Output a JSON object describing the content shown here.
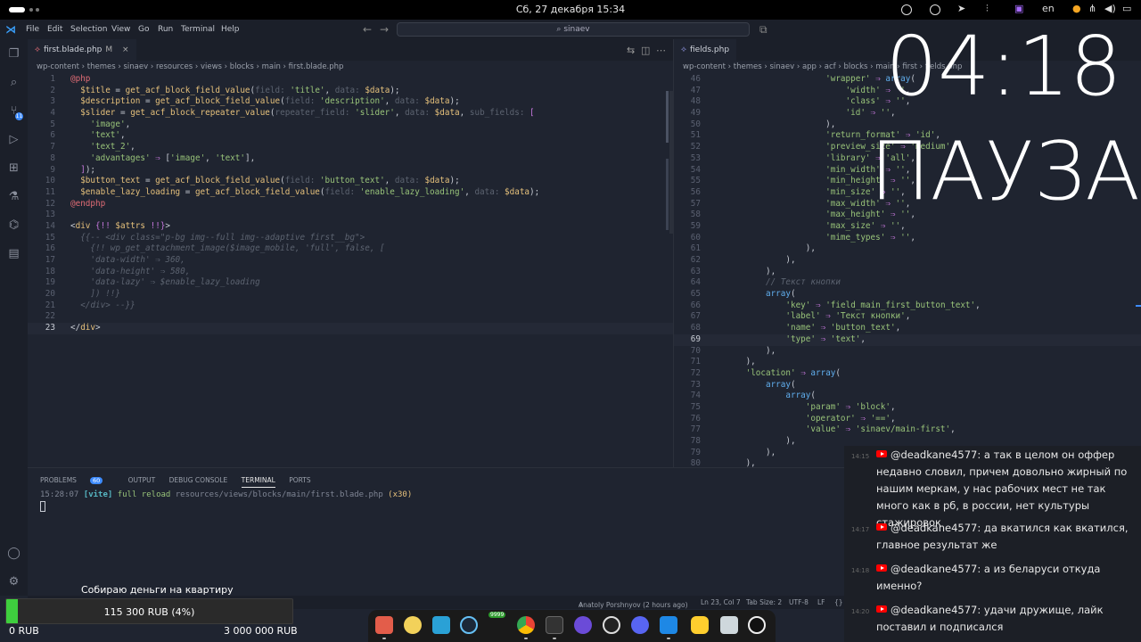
{
  "system": {
    "clock": "Сб, 27 декабря 15:34",
    "keyboard_layout": "en"
  },
  "titlebar": {
    "menu": [
      "File",
      "Edit",
      "Selection",
      "View",
      "Go",
      "Run",
      "Terminal",
      "Help"
    ],
    "search": "sinaev"
  },
  "activity_bar": {
    "scm_badge": "11"
  },
  "editor_left": {
    "tab": "first.blade.php",
    "tab_modified": "M",
    "breadcrumb": [
      "wp-content",
      "themes",
      "sinaev",
      "resources",
      "views",
      "blocks",
      "main",
      "first.blade.php"
    ],
    "current_line": 23,
    "lines": [
      {
        "n": 1,
        "html": "<span style='color:#e06c75'>@php</span>"
      },
      {
        "n": 2,
        "html": "  <span style='color:#e5c07b'>$title</span> = <span style='color:#e5c07b'>get_acf_block_field_value</span>(<span style='color:#5c6370'>field: </span><span style='color:#98c379'>'title'</span>, <span style='color:#5c6370'>data: </span><span style='color:#e5c07b'>$data</span>);"
      },
      {
        "n": 3,
        "html": "  <span style='color:#e5c07b'>$description</span> = <span style='color:#e5c07b'>get_acf_block_field_value</span>(<span style='color:#5c6370'>field: </span><span style='color:#98c379'>'description'</span>, <span style='color:#5c6370'>data: </span><span style='color:#e5c07b'>$data</span>);"
      },
      {
        "n": 4,
        "html": "  <span style='color:#e5c07b'>$slider</span> = <span style='color:#e5c07b'>get_acf_block_repeater_value</span>(<span style='color:#5c6370'>repeater_field: </span><span style='color:#98c379'>'slider'</span>, <span style='color:#5c6370'>data: </span><span style='color:#e5c07b'>$data</span>, <span style='color:#5c6370'>sub_fields: </span><span style='color:#c678dd'>[</span>"
      },
      {
        "n": 5,
        "html": "    <span style='color:#98c379'>'image'</span>,"
      },
      {
        "n": 6,
        "html": "    <span style='color:#98c379'>'text'</span>,"
      },
      {
        "n": 7,
        "html": "    <span style='color:#98c379'>'text_2'</span>,"
      },
      {
        "n": 8,
        "html": "    <span style='color:#98c379'>'advantages'</span> <span style='color:#c678dd'>⇒</span> [<span style='color:#98c379'>'image'</span>, <span style='color:#98c379'>'text'</span>],"
      },
      {
        "n": 9,
        "html": "  <span style='color:#c678dd'>]</span>);"
      },
      {
        "n": 10,
        "html": "  <span style='color:#e5c07b'>$button_text</span> = <span style='color:#e5c07b'>get_acf_block_field_value</span>(<span style='color:#5c6370'>field: </span><span style='color:#98c379'>'button_text'</span>, <span style='color:#5c6370'>data: </span><span style='color:#e5c07b'>$data</span>);"
      },
      {
        "n": 11,
        "html": "  <span style='color:#e5c07b'>$enable_lazy_loading</span> = <span style='color:#e5c07b'>get_acf_block_field_value</span>(<span style='color:#5c6370'>field: </span><span style='color:#98c379'>'enable_lazy_loading'</span>, <span style='color:#5c6370'>data: </span><span style='color:#e5c07b'>$data</span>);"
      },
      {
        "n": 12,
        "html": "<span style='color:#e06c75'>@endphp</span>"
      },
      {
        "n": 13,
        "html": ""
      },
      {
        "n": 14,
        "html": "&lt;<span style='color:#e5c07b'>div</span> <span style='color:#c678dd'>{!!</span> <span style='color:#e5c07b'>$attrs</span> <span style='color:#c678dd'>!!}</span>&gt;"
      },
      {
        "n": 15,
        "html": "  <span style='color:#5c6370;font-style:italic'>{{-- &lt;div class=\"p-bg img--full img--adaptive first__bg\"&gt;</span>"
      },
      {
        "n": 16,
        "html": "    <span style='color:#5c6370;font-style:italic'>{!! wp_get_attachment_image($image_mobile, 'full', false, [</span>"
      },
      {
        "n": 17,
        "html": "    <span style='color:#5c6370;font-style:italic'>'data-width' ⇒ 360,</span>"
      },
      {
        "n": 18,
        "html": "    <span style='color:#5c6370;font-style:italic'>'data-height' ⇒ 580,</span>"
      },
      {
        "n": 19,
        "html": "    <span style='color:#5c6370;font-style:italic'>'data-lazy' ⇒ $enable_lazy_loading</span>"
      },
      {
        "n": 20,
        "html": "    <span style='color:#5c6370;font-style:italic'>]) !!}</span>"
      },
      {
        "n": 21,
        "html": "  <span style='color:#5c6370;font-style:italic'>&lt;/div&gt; --}}</span>"
      },
      {
        "n": 22,
        "html": ""
      },
      {
        "n": 23,
        "html": "&lt;/<span style='color:#e5c07b'>div</span>&gt;"
      }
    ]
  },
  "editor_right": {
    "tab": "fields.php",
    "breadcrumb": [
      "wp-content",
      "themes",
      "sinaev",
      "app",
      "acf",
      "blocks",
      "main",
      "first",
      "fields.php"
    ],
    "current_line": 69,
    "lines": [
      {
        "n": 46,
        "html": "                      <span style='color:#98c379'>'wrapper'</span> <span style='color:#c678dd'>⇒</span> <span style='color:#61afef'>array</span>("
      },
      {
        "n": 47,
        "html": "                          <span style='color:#98c379'>'width'</span> <span style='color:#c678dd'>⇒</span> <span style='color:#98c379'>''</span>,"
      },
      {
        "n": 48,
        "html": "                          <span style='color:#98c379'>'class'</span> <span style='color:#c678dd'>⇒</span> <span style='color:#98c379'>''</span>,"
      },
      {
        "n": 49,
        "html": "                          <span style='color:#98c379'>'id'</span> <span style='color:#c678dd'>⇒</span> <span style='color:#98c379'>''</span>,"
      },
      {
        "n": 50,
        "html": "                      ),"
      },
      {
        "n": 51,
        "html": "                      <span style='color:#98c379'>'return_format'</span> <span style='color:#c678dd'>⇒</span> <span style='color:#98c379'>'id'</span>,"
      },
      {
        "n": 52,
        "html": "                      <span style='color:#98c379'>'preview_size'</span> <span style='color:#c678dd'>⇒</span> <span style='color:#98c379'>'medium'</span>,"
      },
      {
        "n": 53,
        "html": "                      <span style='color:#98c379'>'library'</span> <span style='color:#c678dd'>⇒</span> <span style='color:#98c379'>'all'</span>,"
      },
      {
        "n": 54,
        "html": "                      <span style='color:#98c379'>'min_width'</span> <span style='color:#c678dd'>⇒</span> <span style='color:#98c379'>''</span>,"
      },
      {
        "n": 55,
        "html": "                      <span style='color:#98c379'>'min_height'</span> <span style='color:#c678dd'>⇒</span> <span style='color:#98c379'>''</span>,"
      },
      {
        "n": 56,
        "html": "                      <span style='color:#98c379'>'min_size'</span> <span style='color:#c678dd'>⇒</span> <span style='color:#98c379'>''</span>,"
      },
      {
        "n": 57,
        "html": "                      <span style='color:#98c379'>'max_width'</span> <span style='color:#c678dd'>⇒</span> <span style='color:#98c379'>''</span>,"
      },
      {
        "n": 58,
        "html": "                      <span style='color:#98c379'>'max_height'</span> <span style='color:#c678dd'>⇒</span> <span style='color:#98c379'>''</span>,"
      },
      {
        "n": 59,
        "html": "                      <span style='color:#98c379'>'max_size'</span> <span style='color:#c678dd'>⇒</span> <span style='color:#98c379'>''</span>,"
      },
      {
        "n": 60,
        "html": "                      <span style='color:#98c379'>'mime_types'</span> <span style='color:#c678dd'>⇒</span> <span style='color:#98c379'>''</span>,"
      },
      {
        "n": 61,
        "html": "                  ),"
      },
      {
        "n": 62,
        "html": "              ),"
      },
      {
        "n": 63,
        "html": "          ),"
      },
      {
        "n": 64,
        "html": "          <span style='color:#5c6370;font-style:italic'>// Текст кнопки</span>"
      },
      {
        "n": 65,
        "html": "          <span style='color:#61afef'>array</span>("
      },
      {
        "n": 66,
        "html": "              <span style='color:#98c379'>'key'</span> <span style='color:#c678dd'>⇒</span> <span style='color:#98c379'>'field_main_first_button_text'</span>,"
      },
      {
        "n": 67,
        "html": "              <span style='color:#98c379'>'label'</span> <span style='color:#c678dd'>⇒</span> <span style='color:#98c379'>'Текст кнопки'</span>,"
      },
      {
        "n": 68,
        "html": "              <span style='color:#98c379'>'name'</span> <span style='color:#c678dd'>⇒</span> <span style='color:#98c379'>'button_text'</span>,"
      },
      {
        "n": 69,
        "html": "              <span style='color:#98c379'>'type'</span> <span style='color:#c678dd'>⇒</span> <span style='color:#98c379'>'text'</span>,"
      },
      {
        "n": 70,
        "html": "          ),"
      },
      {
        "n": 71,
        "html": "      ),"
      },
      {
        "n": 72,
        "html": "      <span style='color:#98c379'>'location'</span> <span style='color:#c678dd'>⇒</span> <span style='color:#61afef'>array</span>("
      },
      {
        "n": 73,
        "html": "          <span style='color:#61afef'>array</span>("
      },
      {
        "n": 74,
        "html": "              <span style='color:#61afef'>array</span>("
      },
      {
        "n": 75,
        "html": "                  <span style='color:#98c379'>'param'</span> <span style='color:#c678dd'>⇒</span> <span style='color:#98c379'>'block'</span>,"
      },
      {
        "n": 76,
        "html": "                  <span style='color:#98c379'>'operator'</span> <span style='color:#c678dd'>⇒</span> <span style='color:#98c379'>'=='</span>,"
      },
      {
        "n": 77,
        "html": "                  <span style='color:#98c379'>'value'</span> <span style='color:#c678dd'>⇒</span> <span style='color:#98c379'>'sinaev/main-first'</span>,"
      },
      {
        "n": 78,
        "html": "              ),"
      },
      {
        "n": 79,
        "html": "          ),"
      },
      {
        "n": 80,
        "html": "      ),"
      }
    ]
  },
  "panel": {
    "tabs": [
      "PROBLEMS",
      "OUTPUT",
      "DEBUG CONSOLE",
      "TERMINAL",
      "PORTS"
    ],
    "active_tab": "TERMINAL",
    "problems_count": "60",
    "terminal_time": "15:28:07",
    "terminal_tag": "[vite]",
    "terminal_action": "full reload",
    "terminal_path": "resources/views/blocks/main/first.blade.php",
    "terminal_count": "(x30)"
  },
  "statusbar": {
    "blame": "Anatoly Porshnyov (2 hours ago)",
    "position": "Ln 23, Col 7",
    "tab_size": "Tab Size: 2",
    "encoding": "UTF-8",
    "eol": "LF",
    "braces": "{}"
  },
  "overlay": {
    "timer": "04:18",
    "status": "ПАУЗА"
  },
  "chat": [
    {
      "time": "14:15",
      "author": "@deadkane4577:",
      "text": "а так в целом он оффер недавно словил, причем довольно жирный по нашим меркам, у нас рабочих мест не так много как в рб, в россии, нет культуры стажировок"
    },
    {
      "time": "14:17",
      "author": "@deadkane4577:",
      "text": "да вкатился как вкатился, главное результат же"
    },
    {
      "time": "14:18",
      "author": "@deadkane4577:",
      "text": "а из беларуси откуда именно?"
    },
    {
      "time": "14:20",
      "author": "@deadkane4577:",
      "text": "удачи дружище, лайк поставил и подписался"
    }
  ],
  "goal": {
    "title": "Собираю деньги на квартиру",
    "progress_text": "115 300 RUB (4%)",
    "progress_fraction": 0.04,
    "min": "0 RUB",
    "max": "3 000 000 RUB"
  },
  "dock": {
    "steam_badge": "9999"
  },
  "colors": {
    "editor_bg": "#1f2430",
    "accent": "#3d8bfd",
    "goal_fill": "#3ecf3e",
    "youtube": "#ff0000"
  }
}
